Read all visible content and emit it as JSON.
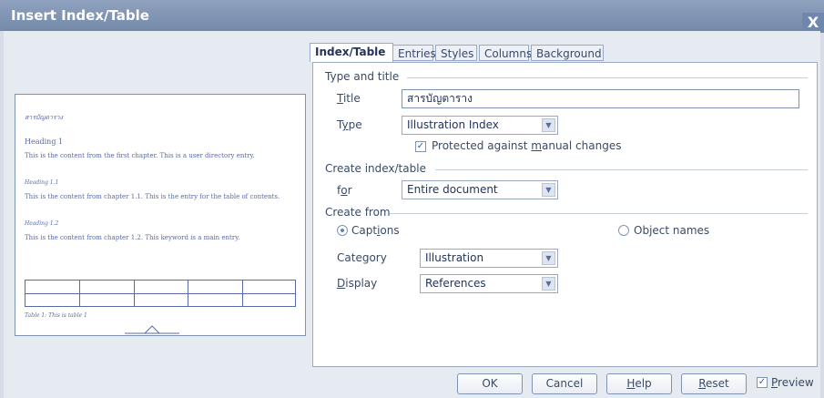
{
  "window": {
    "title": "Insert Index/Table",
    "close_label": "X"
  },
  "preview": {
    "heading_text": "สารบัญตาราง",
    "heading1": "Heading 1",
    "line1": "This is the content from the first chapter. This is a user directory entry.",
    "heading11": "Heading 1.1",
    "line2": "This is the content from chapter 1.1. This is the entry for the table of contents.",
    "heading12": "Heading 1.2",
    "line3": "This is the content from chapter 1.2. This keyword is a main entry.",
    "table_caption": "Table 1: This is table 1"
  },
  "tabs": [
    "Index/Table",
    "Entries",
    "Styles",
    "Columns",
    "Background"
  ],
  "type_and_title": {
    "group_label": "Type and title",
    "title_label": "Title",
    "title_value": "สารบัญตาราง",
    "type_label": "Type",
    "type_value": "Illustration Index",
    "protected_label": "Protected against manual changes",
    "protected_checked": true
  },
  "create_index": {
    "group_label": "Create index/table",
    "for_label": "for",
    "for_value": "Entire document"
  },
  "create_from": {
    "group_label": "Create from",
    "captions_label": "Captions",
    "object_names_label": "Object names",
    "category_label": "Category",
    "category_value": "Illustration",
    "display_label": "Display",
    "display_value": "References"
  },
  "buttons": {
    "ok": "OK",
    "cancel": "Cancel",
    "help": "Help",
    "reset": "Reset",
    "preview": "Preview"
  },
  "colors": {
    "titlebar": "#7f93b2",
    "background": "#e6ebf2",
    "accent": "#6680b3"
  }
}
